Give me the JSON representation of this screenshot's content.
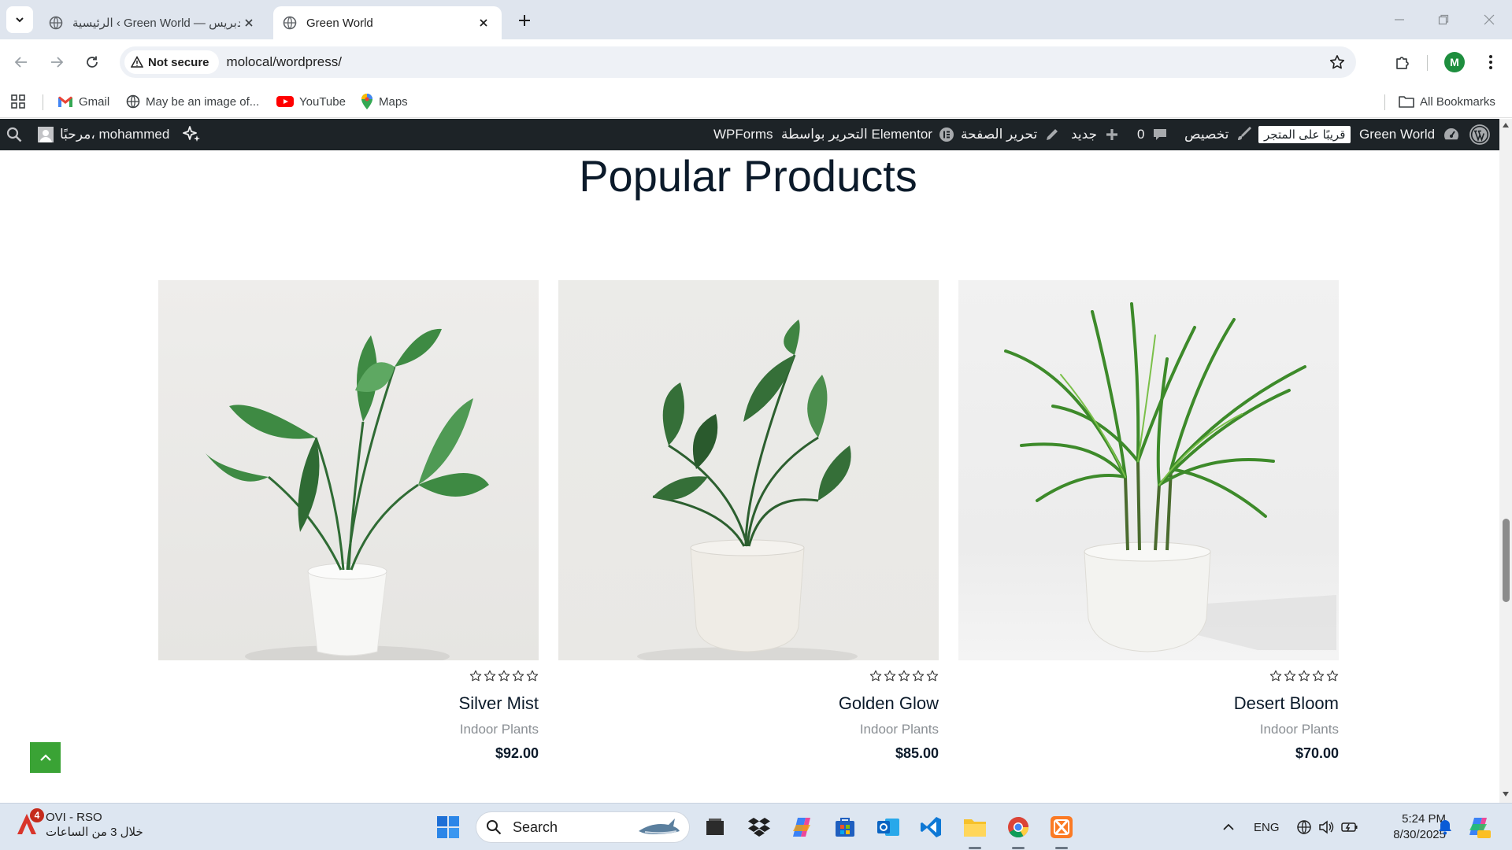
{
  "browser": {
    "tabs": [
      {
        "title": "الرئيسية ‹ Green World — ووردبريس",
        "active": false
      },
      {
        "title": "Green World",
        "active": true
      }
    ],
    "security_chip": "Not secure",
    "url": "molocal/wordpress/",
    "profile_initial": "M",
    "bookmarks": [
      "Gmail",
      "May be an image of...",
      "YouTube",
      "Maps"
    ],
    "all_bookmarks": "All Bookmarks"
  },
  "admin_bar": {
    "site_name": "Green World",
    "visit_store": "قريبًا على المتجر",
    "customize": "تخصيص",
    "comments_count": "0",
    "new": "جديد",
    "edit_page": "تحرير الصفحة",
    "edit_elementor": "التحرير بواسطة Elementor",
    "wpforms": "WPForms",
    "greeting": "مرحبًا، mohammed"
  },
  "section": {
    "heading": "Popular Products"
  },
  "products": [
    {
      "name": "Silver Mist",
      "category": "Indoor Plants",
      "price": "$92.00",
      "rating": 0
    },
    {
      "name": "Golden Glow",
      "category": "Indoor Plants",
      "price": "$85.00",
      "rating": 0
    },
    {
      "name": "Desert Bloom",
      "category": "Indoor Plants",
      "price": "$70.00",
      "rating": 0
    }
  ],
  "taskbar": {
    "notif_badge": "4",
    "notif_title": "OVI - RSO",
    "notif_sub": "خلال 3 من الساعات",
    "search_placeholder": "Search",
    "lang": "ENG",
    "time": "5:24 PM",
    "date": "8/30/2025"
  },
  "colors": {
    "accent_green": "#3aa335",
    "admin_bar": "#1d2327",
    "heading": "#0b1a2a"
  }
}
